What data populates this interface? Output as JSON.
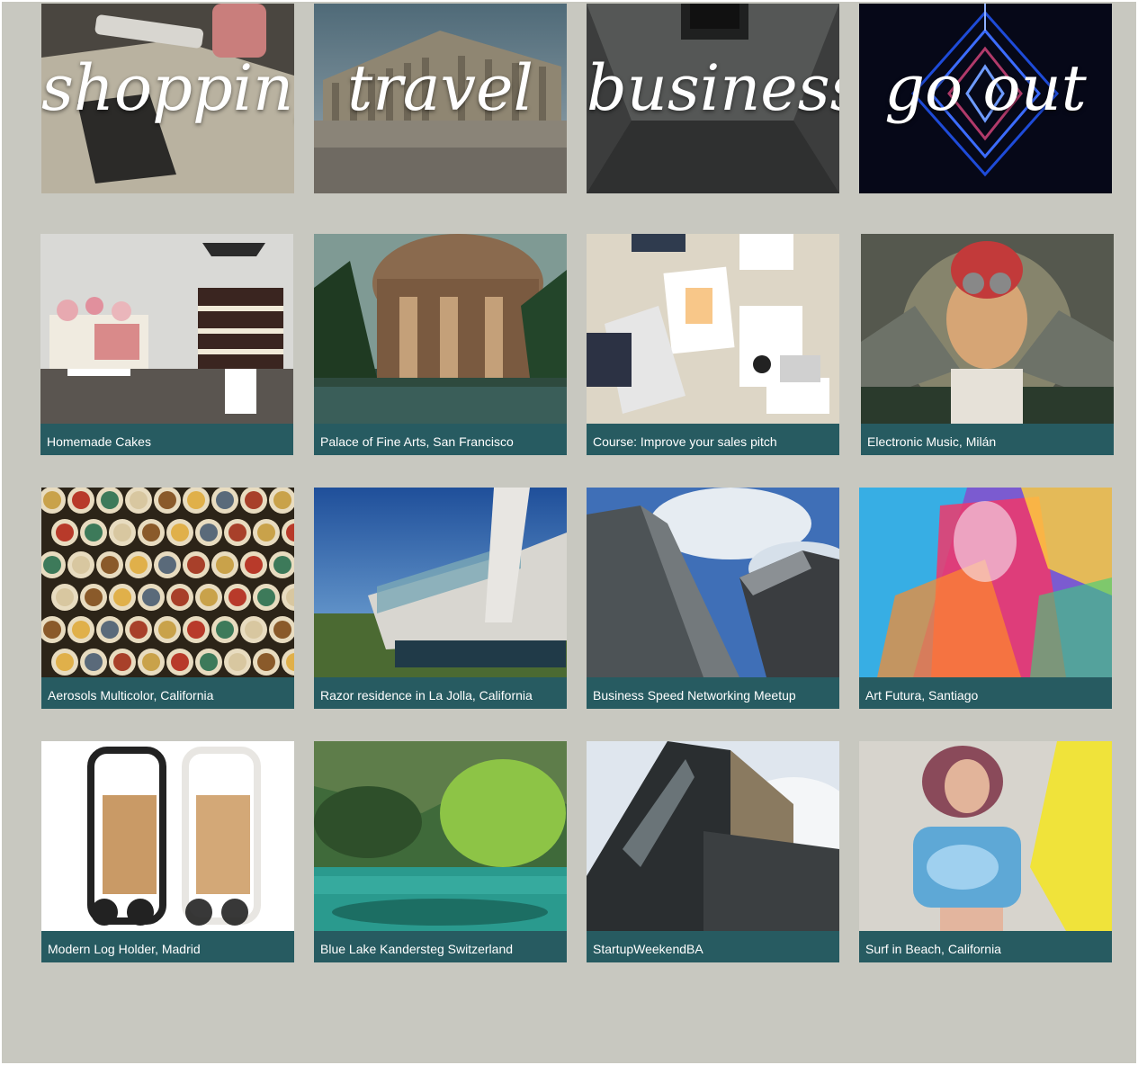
{
  "categories": [
    {
      "label": "shopping"
    },
    {
      "label": "travel"
    },
    {
      "label": "business"
    },
    {
      "label": "go out"
    }
  ],
  "cards": [
    {
      "caption": "Homemade Cakes",
      "image": "cakes-photo"
    },
    {
      "caption": "Palace of Fine Arts, San Francisco",
      "image": "palace-photo"
    },
    {
      "caption": "Course: Improve your sales pitch",
      "image": "meeting-photo"
    },
    {
      "caption": "Electronic Music, Milán",
      "image": "helmet-girl-photo"
    },
    {
      "caption": "Aerosols Multicolor, California",
      "image": "spray-caps-photo"
    },
    {
      "caption": "Razor residence in La Jolla, California",
      "image": "modern-house-photo"
    },
    {
      "caption": "Business Speed Networking Meetup",
      "image": "skyscrapers-photo"
    },
    {
      "caption": "Art Futura, Santiago",
      "image": "abstract-art-photo"
    },
    {
      "caption": "Modern Log Holder, Madrid",
      "image": "log-holder-photo"
    },
    {
      "caption": "Blue Lake Kandersteg Switzerland",
      "image": "lake-photo"
    },
    {
      "caption": "StartupWeekendBA",
      "image": "office-building-photo"
    },
    {
      "caption": "Surf in Beach, California",
      "image": "surfer-photo"
    }
  ],
  "colors": {
    "background": "#c8c8c0",
    "caption_bar": "#275b61",
    "caption_text": "#ffffff"
  }
}
